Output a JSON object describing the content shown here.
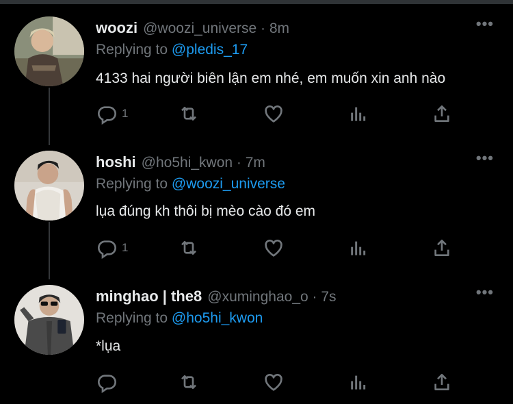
{
  "colors": {
    "background": "#000000",
    "text": "#e7e9ea",
    "muted": "#71767b",
    "link": "#1d9bf0",
    "thread_line": "#333639"
  },
  "icons": {
    "reply": "reply-icon",
    "retweet": "retweet-icon",
    "like": "heart-icon",
    "views": "views-icon",
    "share": "share-icon",
    "more": "more-icon"
  },
  "tweets": [
    {
      "name": "woozi",
      "handle": "@woozi_universe · 8m",
      "replying_label": "Replying to",
      "replying_to": "@pledis_17",
      "text": "4133 hai người biên lận em nhé, em muốn xin anh nào",
      "reply_count": "1",
      "more": "•••"
    },
    {
      "name": "hoshi",
      "handle": "@ho5hi_kwon · 7m",
      "replying_label": "Replying to",
      "replying_to": "@woozi_universe",
      "text": "lụa đúng kh thôi bị mèo cào đó em",
      "reply_count": "1",
      "more": "•••"
    },
    {
      "name": "minghao | the8",
      "handle": "@xuminghao_o · 7s",
      "replying_label": "Replying to",
      "replying_to": "@ho5hi_kwon",
      "text": "*lụa",
      "reply_count": "",
      "more": "•••"
    }
  ]
}
